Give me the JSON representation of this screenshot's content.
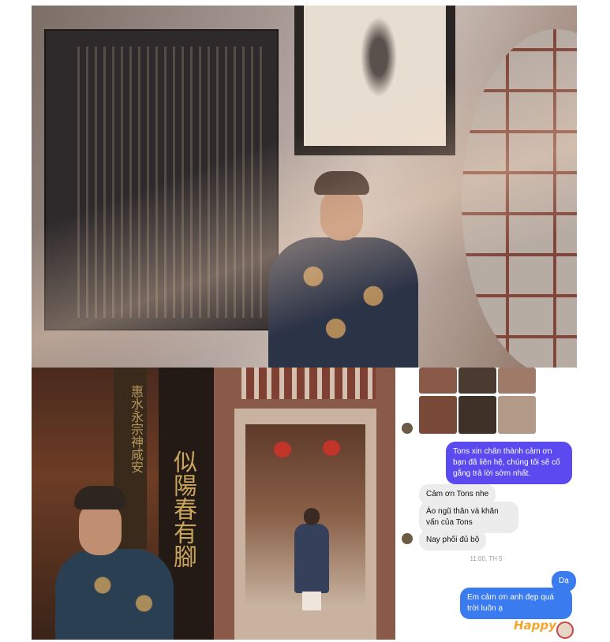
{
  "photos": {
    "top": {
      "description_icon": "photo-man-in-ao-dai-with-plaque"
    },
    "bottom_left": {
      "pillar_text": "似陽春有腳",
      "pillar2_text": "惠水永宗神咸安"
    },
    "bottom_middle": {
      "description_icon": "photo-man-in-temple-doorway"
    }
  },
  "chat": {
    "messages": [
      {
        "side": "out",
        "text": "Tons xin chân thành cảm ơn bạn đã liên hệ, chúng tôi sẽ cố gắng trả lời sớm nhất."
      },
      {
        "side": "in",
        "text": "Cảm ơn Tons nhe"
      },
      {
        "side": "in",
        "text": "Áo ngũ thân và khăn vấn của Tons"
      },
      {
        "side": "in",
        "text": "Nay phối đủ bộ"
      },
      {
        "side": "out",
        "text": "Dạ"
      },
      {
        "side": "out",
        "text": "Em cảm ơn anh đẹp quá trời luôn ạ"
      }
    ],
    "timestamp": "11:00, TH 5",
    "sticker_text": "Happy"
  },
  "colors": {
    "outgoing_bubble": "#5b4af0",
    "outgoing_bubble_2": "#3a7bf0",
    "incoming_bubble": "#ececec"
  }
}
